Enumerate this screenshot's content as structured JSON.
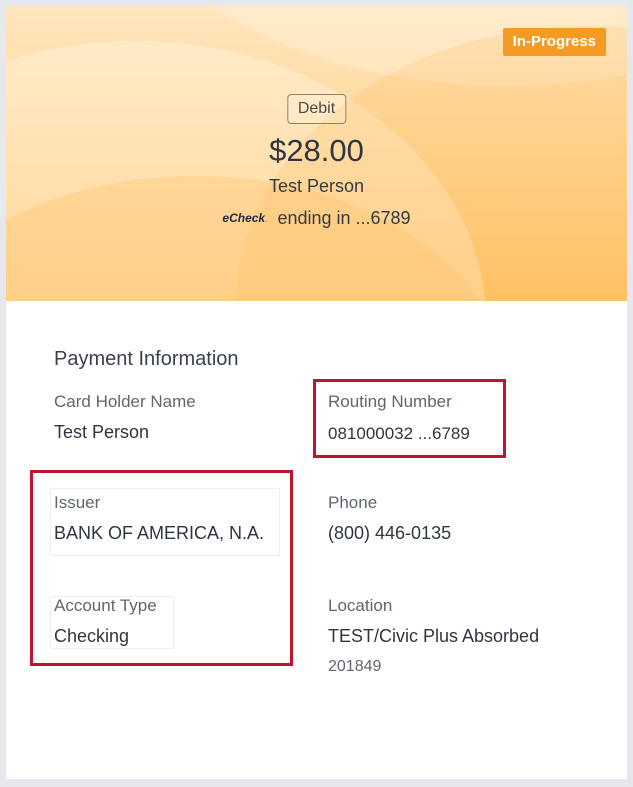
{
  "hero": {
    "status": "In-Progress",
    "type": "Debit",
    "amount": "$28.00",
    "holder_name": "Test Person",
    "method_logo": "eCheck",
    "method_logo_dot": ".",
    "method_ending": "ending in ...6789",
    "colors": {
      "status_badge": "#f59a23",
      "hero_gradient_top": "#ffe6bf",
      "hero_gradient_bottom": "#ffc46a"
    }
  },
  "payment_info": {
    "title": "Payment Information",
    "card_holder": {
      "label": "Card Holder Name",
      "value": "Test Person"
    },
    "routing": {
      "label": "Routing Number",
      "value": "081000032 ...6789"
    },
    "issuer": {
      "label": "Issuer",
      "value": "BANK OF AMERICA, N.A."
    },
    "phone": {
      "label": "Phone",
      "value": "(800) 446-0135"
    },
    "account_type": {
      "label": "Account Type",
      "value": "Checking"
    },
    "location": {
      "label": "Location",
      "value": "TEST/Civic Plus Absorbed",
      "sub": "201849"
    }
  },
  "annotation_color": "#c0152f"
}
